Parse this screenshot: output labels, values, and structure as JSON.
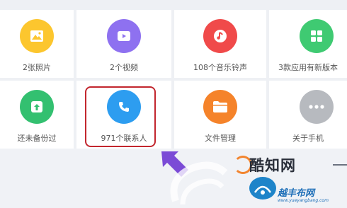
{
  "tiles": [
    {
      "label": "2张照片",
      "icon": "photo-icon",
      "color": "#fcc62e"
    },
    {
      "label": "2个视频",
      "icon": "video-icon",
      "color": "#8e71f0"
    },
    {
      "label": "108个音乐铃声",
      "icon": "music-icon",
      "color": "#f04a4a"
    },
    {
      "label": "3款应用有新版本",
      "icon": "apps-icon",
      "color": "#3fca72"
    },
    {
      "label": "还未备份过",
      "icon": "backup-icon",
      "color": "#33c070"
    },
    {
      "label": "971个联系人",
      "icon": "phone-icon",
      "color": "#2d9df0"
    },
    {
      "label": "文件管理",
      "icon": "folder-icon",
      "color": "#f5832a"
    },
    {
      "label": "关于手机",
      "icon": "more-icon",
      "color": "#b7babf"
    }
  ],
  "highlight_color": "#c2262e",
  "watermark": {
    "site": "酷知网",
    "brand": "越丰布网",
    "url": "www.yueyangbang.com"
  }
}
